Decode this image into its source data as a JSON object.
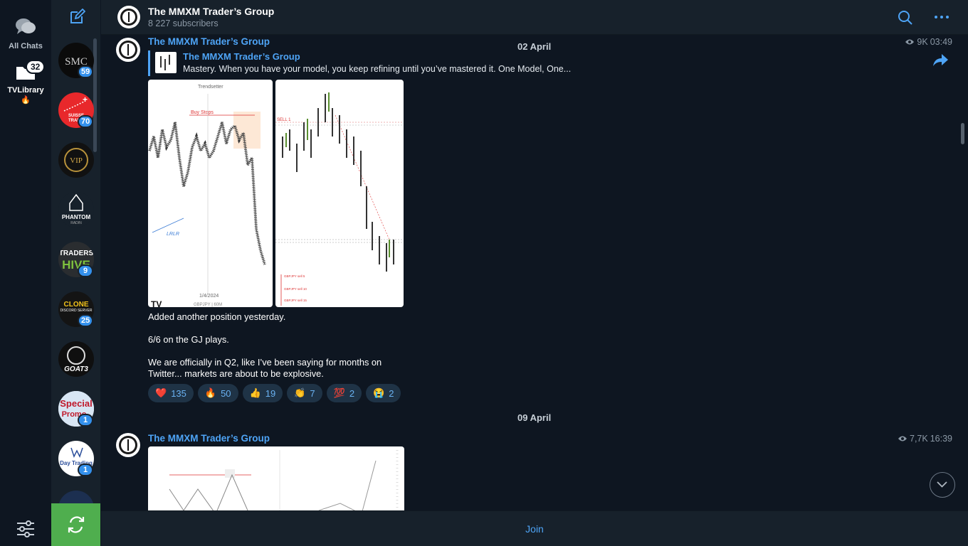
{
  "folders": {
    "all_chats_label": "All Chats",
    "library_label": "TVLibrary",
    "library_emoji": "🔥",
    "library_badge": "32"
  },
  "chat_list": {
    "items": [
      {
        "name": "SMC",
        "badge": "59"
      },
      {
        "name": "SUISSE TRADING",
        "badge": "70"
      },
      {
        "name": "VIP",
        "badge": ""
      },
      {
        "name": "PHANTOM RADIN",
        "badge": ""
      },
      {
        "name": "TRADERS HIVE",
        "badge": "9"
      },
      {
        "name": "CLONE DISCORD SERVER",
        "badge": "25"
      },
      {
        "name": "GOAT3",
        "badge": ""
      },
      {
        "name": "Special Promo",
        "badge": "1"
      },
      {
        "name": "Day Trading Institute",
        "badge": "1"
      }
    ]
  },
  "header": {
    "title": "The MMXM Trader’s Group",
    "subtitle": "8 227 subscribers"
  },
  "messages": [
    {
      "sender": "The MMXM Trader’s Group",
      "date": "02 April",
      "views": "9K",
      "time": "03:49",
      "reply_name": "The MMXM Trader’s Group",
      "reply_text": "Mastery.   When you have your model, you keep refining until you’ve mastered it.  One Model, One...",
      "photo1": {
        "caption_top": "Trendsetter",
        "label_buy": "Buy Stops",
        "label_lrlr": "LRLR",
        "date": "1/4/2024",
        "pair": "GBPJPY | 60M"
      },
      "photo2": {
        "label_sell": "SELL 1",
        "rows": [
          "GBPJPY sell 5",
          "GBPJPY sell 10",
          "GBPJPY sell 15"
        ]
      },
      "text": [
        "Added another position yesterday.",
        "6/6 on the GJ plays.",
        "We are officially in Q2, like I’ve been saying for months on Twitter... markets are about to be explosive."
      ],
      "reactions": [
        {
          "emoji": "❤️",
          "count": "135"
        },
        {
          "emoji": "🔥",
          "count": "50"
        },
        {
          "emoji": "👍",
          "count": "19"
        },
        {
          "emoji": "👏",
          "count": "7"
        },
        {
          "emoji": "💯",
          "count": "2"
        },
        {
          "emoji": "😭",
          "count": "2"
        }
      ]
    },
    {
      "sender": "The MMXM Trader’s Group",
      "date": "09 April",
      "views": "7,7K",
      "time": "16:39"
    }
  ],
  "footer": {
    "join_label": "Join"
  },
  "colors": {
    "accent": "#4ea4f6",
    "green": "#4fae4e",
    "bg": "#0e1621",
    "panel": "#17212b"
  }
}
